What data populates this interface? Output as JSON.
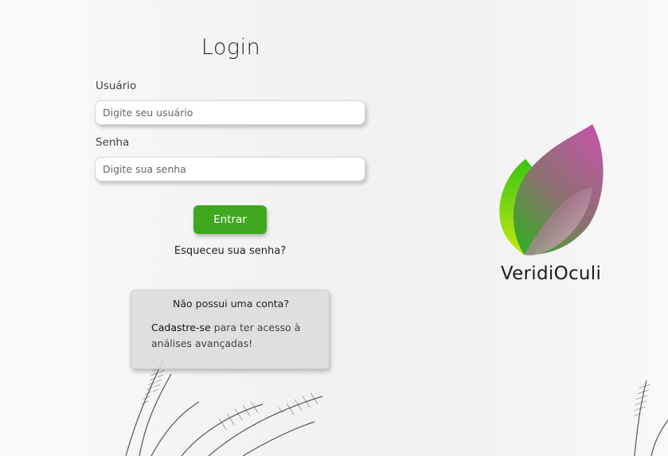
{
  "login": {
    "title": "Login",
    "username_label": "Usuário",
    "username_placeholder": "Digite seu usuário",
    "username_value": "",
    "password_label": "Senha",
    "password_placeholder": "Digite sua senha",
    "password_value": "",
    "submit_label": "Entrar",
    "forgot_label": "Esqueceu sua senha?"
  },
  "signup": {
    "title": "Não possui uma conta?",
    "link_label": "Cadastre-se",
    "text": " para ter acesso à análises avançadas!"
  },
  "brand": {
    "name": "VeridiOculi",
    "icon": "leaf-logo-icon"
  },
  "colors": {
    "primary_button": "#3fa81f",
    "leaf_green": "#55cc11",
    "leaf_purple": "#b05a9a"
  }
}
